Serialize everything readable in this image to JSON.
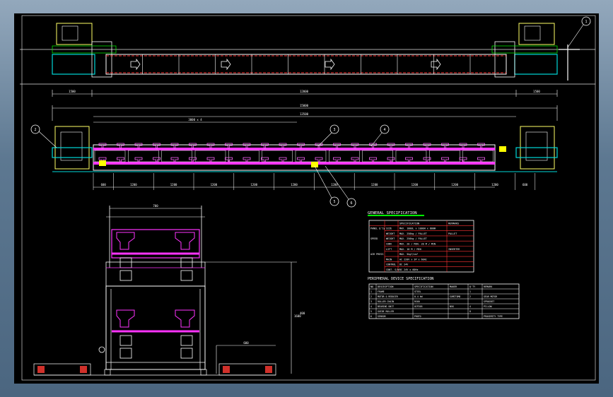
{
  "drawing": {
    "top_view": {
      "dims_bottom": [
        "1500",
        "12000",
        "1500"
      ]
    },
    "side_view": {
      "dim_overall": "15000",
      "dim_inner": "13500",
      "dim_sub": "3000 x 4",
      "dims_bottom": [
        "600",
        "1200",
        "1200",
        "1200",
        "1200",
        "1200",
        "1200",
        "1200",
        "1200",
        "1200",
        "1200",
        "600"
      ]
    },
    "balloons": [
      "1",
      "2",
      "3",
      "4",
      "5",
      "6"
    ],
    "section_view": {
      "dim_width": "700",
      "dim_height": "1600",
      "dim_side": "600",
      "dim_small": "400"
    }
  },
  "general_spec": {
    "title": "GENERAL SPECIFICATION",
    "headers": [
      "",
      "",
      "SPECIFICATION",
      "REMARKS"
    ],
    "rows": [
      [
        "PANEL Q'ty",
        "SIZE",
        "MAX. 1000L x 1000H x 800W",
        ""
      ],
      [
        "",
        "WEIGHT",
        "MAX. 250kg / PALLET",
        "PALLET"
      ],
      [
        "SPEED",
        "WEIGHT",
        "MAX. 250kg / PALLET",
        ""
      ],
      [
        "",
        "CONV",
        "MAX. 20 / MIN. 20 M / MIN",
        ""
      ],
      [
        "",
        "LIFT",
        "MAX. 10 M / MIN",
        "INVERTER"
      ],
      [
        "AIR PRESS",
        "",
        "MAX. 5kgf/cm²",
        ""
      ],
      [
        "",
        "MAIN",
        "AC 220V x 3P x 60Hz",
        ""
      ],
      [
        "",
        "CONTROL",
        "DC 24V",
        ""
      ],
      [
        "",
        "CONT. S/W",
        "DC 24V x 60Hz",
        ""
      ]
    ]
  },
  "parts_spec": {
    "title": "PERIPHERAL DEVICE SPECIFICATION",
    "headers": [
      "NO",
      "DESCRIPTION",
      "SPECIFICATION",
      "MAKER",
      "Q'TY",
      "REMARK"
    ],
    "rows": [
      [
        "1",
        "FRAME",
        "STEEL",
        "",
        "1",
        ""
      ],
      [
        "2",
        "MOTOR & REDUCER",
        "0.4 kW",
        "SUMITOMO",
        "2",
        "GEAR MOTOR"
      ],
      [
        "3",
        "ROLLER CHAIN",
        "RS60",
        "",
        "",
        "SPROCKET"
      ],
      [
        "4",
        "BEARING UNIT",
        "UCP205",
        "NSK",
        "4",
        "PILLOW"
      ],
      [
        "5",
        "GUIDE ROLLER",
        "",
        "",
        "8",
        ""
      ],
      [
        "6",
        "SENSOR",
        "PHOTO",
        "",
        "",
        "PROXIMITY  TYPE"
      ]
    ]
  }
}
